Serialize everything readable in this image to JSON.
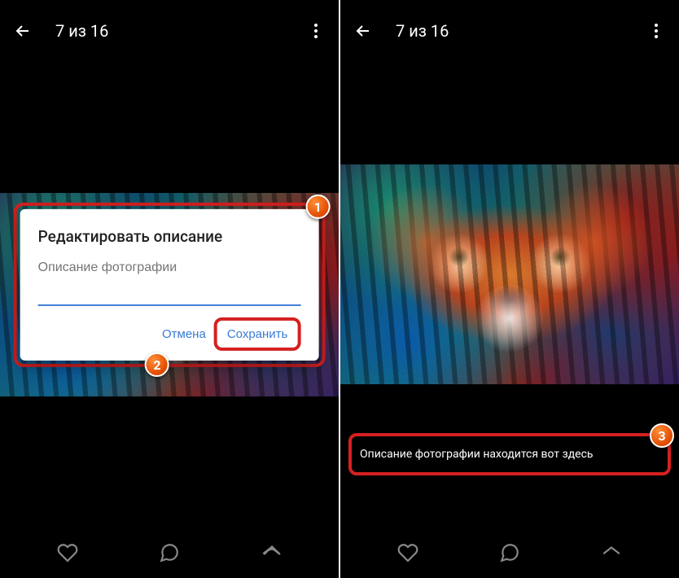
{
  "left": {
    "counter": "7 из 16",
    "dialog": {
      "title": "Редактировать описание",
      "placeholder": "Описание фотографии",
      "cancel": "Отмена",
      "save": "Сохранить"
    },
    "badges": {
      "one": "1",
      "two": "2"
    }
  },
  "right": {
    "counter": "7 из 16",
    "caption": "Описание фотографии находится вот здесь",
    "badges": {
      "three": "3"
    }
  }
}
